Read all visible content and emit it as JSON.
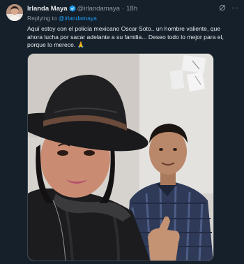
{
  "tweet": {
    "display_name": "Irlanda Maya",
    "handle": "@irlandamaya",
    "separator": "·",
    "time": "18h",
    "reply_prefix": "Replying to",
    "reply_to": "@irlandamaya",
    "text": "Aquí estoy con el policía mexicano Oscar Soto.. un hombre valiente, que ahora lucha por sacar adelante a su familia... Deseo todo lo mejor para el, porque lo merece. 🙏"
  },
  "header_actions": {
    "grok_icon": "grok-icon",
    "more_icon": "more-icon",
    "more_glyph": "···",
    "grok_glyph": "⊘"
  },
  "colors": {
    "background": "#15202b",
    "text_primary": "#e7e9ea",
    "text_secondary": "#8b98a5",
    "accent": "#1d9bf0",
    "verified": "#1d9bf0"
  }
}
